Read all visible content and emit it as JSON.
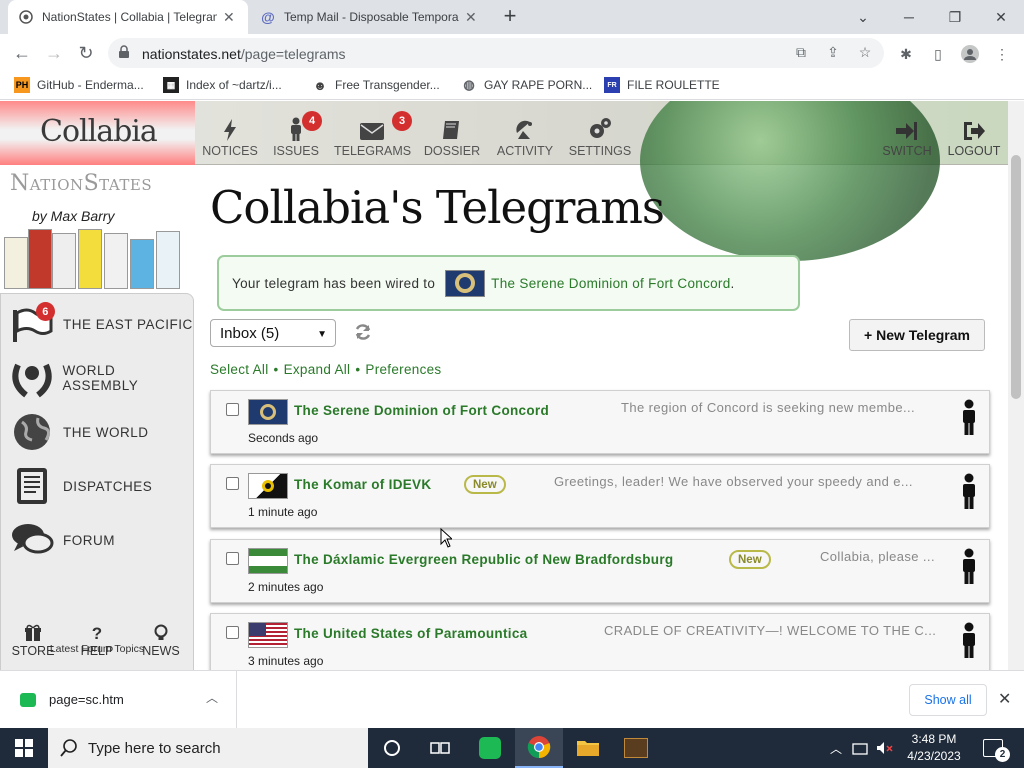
{
  "browser": {
    "tabs": [
      {
        "title": "NationStates | Collabia | Telegrams"
      },
      {
        "title": "Temp Mail - Disposable Temporary Email"
      }
    ],
    "url_host": "nationstates.net",
    "url_path": "/page=telegrams",
    "bookmarks": [
      {
        "label": "GitHub - Enderma...",
        "icon": "ph-icon"
      },
      {
        "label": "Index of ~dartz/i...",
        "icon": "qr-icon"
      },
      {
        "label": "Free Transgender...",
        "icon": "mask-icon"
      },
      {
        "label": "GAY RAPE PORN...",
        "icon": "globe-icon"
      },
      {
        "label": "FILE ROULETTE",
        "icon": "file-icon"
      }
    ]
  },
  "site": {
    "nation_logo": "Collabia",
    "nav": [
      {
        "label": "NOTICES",
        "icon": "lightning-icon"
      },
      {
        "label": "ISSUES",
        "icon": "person-icon",
        "badge": "4"
      },
      {
        "label": "TELEGRAMS",
        "icon": "envelope-icon",
        "badge": "3"
      },
      {
        "label": "DOSSIER",
        "icon": "book-icon"
      },
      {
        "label": "ACTIVITY",
        "icon": "satellite-icon"
      },
      {
        "label": "SETTINGS",
        "icon": "gears-icon"
      }
    ],
    "nav_right": [
      {
        "label": "SWITCH",
        "icon": "switch-icon"
      },
      {
        "label": "LOGOUT",
        "icon": "logout-icon"
      }
    ],
    "brand": "NationStates",
    "byline": "by Max Barry",
    "sidebar": [
      {
        "label": "THE EAST PACIFIC",
        "badge": "6",
        "icon": "flag-icon"
      },
      {
        "label": "WORLD ASSEMBLY",
        "icon": "laurel-icon"
      },
      {
        "label": "THE WORLD",
        "icon": "globe-icon"
      },
      {
        "label": "DISPATCHES",
        "icon": "document-icon"
      },
      {
        "label": "FORUM",
        "icon": "speech-bubbles-icon"
      }
    ],
    "small_nav": [
      {
        "label": "STORE",
        "icon": "gift-icon"
      },
      {
        "label": "HELP",
        "icon": "question-icon"
      },
      {
        "label": "NEWS",
        "icon": "lightbulb-icon"
      }
    ],
    "latest_forum": "Latest Forum Topics"
  },
  "main": {
    "title": "Collabia's Telegrams",
    "notice_prefix": "Your telegram has been wired to",
    "notice_target": "The Serene Dominion of Fort Concord",
    "notice_suffix": ".",
    "folder": "Inbox (5)",
    "new_telegram": "+ New Telegram",
    "actions": [
      "Select All",
      "Expand All",
      "Preferences"
    ],
    "telegrams": [
      {
        "from": "The Serene Dominion of Fort Concord",
        "preview": "The region of Concord is seeking new membe...",
        "time": "Seconds ago",
        "new": false
      },
      {
        "from": "The Komar of IDEVK",
        "preview": "Greetings, leader! We have observed your speedy and e...",
        "time": "1 minute ago",
        "new": true
      },
      {
        "from": "The Dáxlamic Evergreen Republic of New Bradfordsburg",
        "preview": "Collabia, please ...",
        "time": "2 minutes ago",
        "new": true
      },
      {
        "from": "The United States of Paramountica",
        "preview": "CRADLE OF CREATIVITY—! WELCOME TO THE C...",
        "time": "3 minutes ago",
        "new": false
      }
    ],
    "new_label": "New"
  },
  "download": {
    "file": "page=sc.htm",
    "show_all": "Show all"
  },
  "taskbar": {
    "search_placeholder": "Type here to search",
    "time": "3:48 PM",
    "date": "4/23/2023",
    "notifications": "2"
  }
}
